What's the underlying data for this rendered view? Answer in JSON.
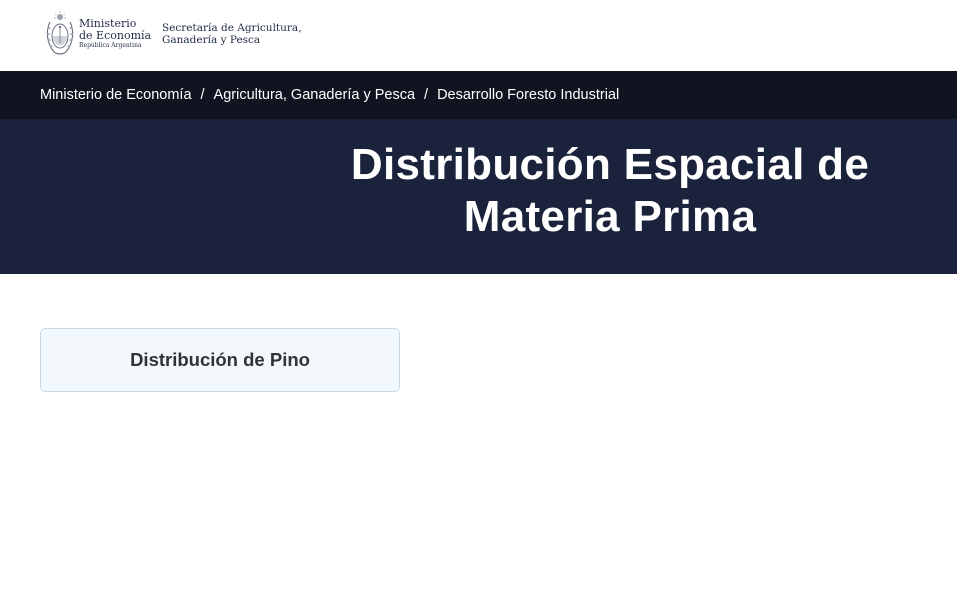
{
  "header": {
    "logo": {
      "line1": "Ministerio",
      "line2": "de Economía",
      "line3": "República Argentina"
    },
    "secretaria": {
      "line1": "Secretaría de Agricultura,",
      "line2": "Ganadería y Pesca"
    }
  },
  "breadcrumb": {
    "items": [
      "Ministerio de Economía",
      "Agricultura, Ganadería y Pesca",
      "Desarrollo Foresto Industrial"
    ],
    "separator": "/"
  },
  "hero": {
    "title_line1": "Distribución Espacial de",
    "title_line2": "Materia Prima"
  },
  "cards": [
    {
      "label": "Distribución de Pino"
    }
  ],
  "colors": {
    "breadcrumb_bg": "#0f1420",
    "hero_bg": "#1b223b",
    "card_bg": "#f3f8fc",
    "card_border": "#c9d9e6",
    "brand_text": "#1f2a44"
  },
  "icons": {
    "emblem": "argentina-coat-of-arms-icon"
  }
}
